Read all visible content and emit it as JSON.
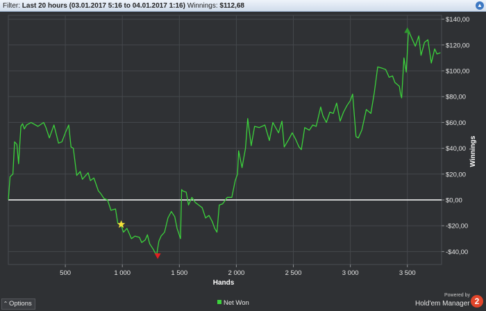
{
  "filter": {
    "prefix": "Filter:",
    "range": "Last 20 hours (03.01.2017 5:16 to 04.01.2017 1:16)",
    "winnings_label": "Winnings:",
    "winnings_value": "$112,68",
    "toggle_icon": "chevron-up-icon"
  },
  "options_label": "Options",
  "legend_label": "Net Won",
  "brand": {
    "powered": "Powered by",
    "name": "Hold'em Manager",
    "logo": "2"
  },
  "colors": {
    "line": "#3cd33c",
    "zero_line": "#ffffff",
    "background": "#2f3134",
    "grid": "#45484c"
  },
  "chart_data": {
    "type": "line",
    "xlabel": "Hands",
    "ylabel": "Winnings",
    "xlim": [
      0,
      3800
    ],
    "ylim": [
      -50,
      143
    ],
    "x_ticks": [
      500,
      1000,
      1500,
      2000,
      2500,
      3000,
      3500
    ],
    "x_tick_labels": [
      "500",
      "1 000",
      "1 500",
      "2 000",
      "2 500",
      "3 000",
      "3 500"
    ],
    "y_ticks": [
      140,
      120,
      100,
      80,
      60,
      40,
      20,
      0,
      -20,
      -40
    ],
    "y_tick_labels": [
      "$140,00",
      "$120,00",
      "$100,00",
      "$80,00",
      "$60,00",
      "$40,00",
      "$20,00",
      "$0,00",
      "-$20,00",
      "-$40,00"
    ],
    "y_axis_side": "right",
    "grid": true,
    "legend": "bottom-center",
    "series": [
      {
        "name": "Net Won",
        "x": [
          0,
          15,
          40,
          55,
          75,
          90,
          110,
          125,
          140,
          160,
          200,
          260,
          310,
          330,
          360,
          400,
          440,
          470,
          500,
          530,
          550,
          570,
          600,
          630,
          650,
          700,
          720,
          750,
          790,
          810,
          840,
          870,
          900,
          940,
          960,
          990,
          1010,
          1040,
          1080,
          1110,
          1150,
          1170,
          1200,
          1220,
          1240,
          1270,
          1300,
          1320,
          1340,
          1370,
          1400,
          1430,
          1460,
          1480,
          1510,
          1520,
          1530,
          1560,
          1580,
          1610,
          1640,
          1670,
          1700,
          1730,
          1760,
          1790,
          1810,
          1830,
          1850,
          1880,
          1920,
          1960,
          1990,
          2010,
          2020,
          2050,
          2080,
          2100,
          2130,
          2160,
          2200,
          2250,
          2290,
          2320,
          2370,
          2400,
          2420,
          2460,
          2490,
          2520,
          2550,
          2570,
          2600,
          2640,
          2670,
          2700,
          2740,
          2760,
          2790,
          2820,
          2850,
          2880,
          2910,
          2940,
          2970,
          3000,
          3020,
          3050,
          3070,
          3100,
          3140,
          3180,
          3210,
          3240,
          3280,
          3310,
          3340,
          3370,
          3390,
          3430,
          3440,
          3450,
          3470,
          3490,
          3510,
          3540,
          3570,
          3600,
          3620,
          3650,
          3680,
          3710,
          3740,
          3760,
          3790
        ],
        "y": [
          0,
          18,
          20,
          45,
          43,
          28,
          57,
          59,
          55,
          58,
          60,
          57,
          60,
          56,
          48,
          58,
          44,
          45,
          52,
          58,
          41,
          40,
          19,
          22,
          16,
          21,
          15,
          17,
          7,
          5,
          1,
          0,
          -8,
          -7,
          -18,
          -20,
          -25,
          -22,
          -30,
          -28,
          -29,
          -33,
          -31,
          -27,
          -34,
          -38,
          -43,
          -32,
          -28,
          -25,
          -14,
          -9,
          -13,
          -22,
          -30,
          8,
          7,
          6,
          -4,
          2,
          -2,
          -4,
          -6,
          -14,
          -12,
          -17,
          -22,
          -25,
          -4,
          -3,
          2,
          2,
          15,
          20,
          38,
          25,
          40,
          63,
          42,
          57,
          56,
          58,
          46,
          60,
          52,
          61,
          41,
          47,
          52,
          47,
          41,
          39,
          56,
          54,
          58,
          57,
          72,
          65,
          60,
          68,
          67,
          75,
          61,
          68,
          73,
          77,
          82,
          49,
          48,
          54,
          70,
          67,
          83,
          103,
          102,
          101,
          95,
          96,
          91,
          88,
          82,
          79,
          110,
          99,
          131,
          125,
          119,
          127,
          112,
          122,
          124,
          106,
          117,
          113,
          114
        ]
      }
    ],
    "markers": [
      {
        "type": "max",
        "x": 3500,
        "y": 131,
        "color": "#2f9a2f"
      },
      {
        "type": "min",
        "x": 1310,
        "y": -43,
        "color": "#e02020"
      },
      {
        "type": "star",
        "x": 990,
        "y": -19,
        "color": "#f5e33a"
      }
    ]
  }
}
